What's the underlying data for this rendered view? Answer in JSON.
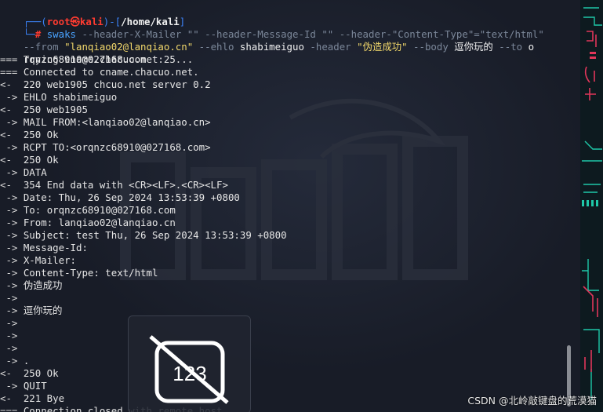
{
  "prompt": {
    "corner_top": "┌──(",
    "user": "root㉿kali",
    "mid": ")-[",
    "path": "/home/kali",
    "close": "]",
    "corner_bottom": "└─",
    "symbol": "#"
  },
  "command": {
    "tool": "swaks",
    "line1_rest": " --header-X-Mailer \"\" --header-Message-Id \"\" --header-\"Content-Type\"=\"text/html\"",
    "line2_a": "--from ",
    "line2_from": "\"lanqiao02@lanqiao.cn\"",
    "line2_b": " --ehlo ",
    "line2_ehlo": "shabimeiguo",
    "line2_c": " -header ",
    "line2_header": "\"伪造成功\"",
    "line2_d": " --body ",
    "line2_body": "逗你玩的",
    "line2_e": " --to ",
    "line2_to_start": "o",
    "line3": "rqnzc68910@027168.com"
  },
  "output_lines": [
    {
      "prefix": "===",
      "text": " Trying cname.chacuo.net:25..."
    },
    {
      "prefix": "===",
      "text": " Connected to cname.chacuo.net."
    },
    {
      "prefix": "<-",
      "text": "  220 web1905 chcuo.net server 0.2"
    },
    {
      "prefix": " ->",
      "text": " EHLO shabimeiguo"
    },
    {
      "prefix": "<-",
      "text": "  250 web1905"
    },
    {
      "prefix": " ->",
      "text": " MAIL FROM:<lanqiao02@lanqiao.cn>"
    },
    {
      "prefix": "<-",
      "text": "  250 Ok"
    },
    {
      "prefix": " ->",
      "text": " RCPT TO:<orqnzc68910@027168.com>"
    },
    {
      "prefix": "<-",
      "text": "  250 Ok"
    },
    {
      "prefix": " ->",
      "text": " DATA"
    },
    {
      "prefix": "<-",
      "text": "  354 End data with <CR><LF>.<CR><LF>"
    },
    {
      "prefix": " ->",
      "text": " Date: Thu, 26 Sep 2024 13:53:39 +0800"
    },
    {
      "prefix": " ->",
      "text": " To: orqnzc68910@027168.com"
    },
    {
      "prefix": " ->",
      "text": " From: lanqiao02@lanqiao.cn"
    },
    {
      "prefix": " ->",
      "text": " Subject: test Thu, 26 Sep 2024 13:53:39 +0800"
    },
    {
      "prefix": " ->",
      "text": " Message-Id:"
    },
    {
      "prefix": " ->",
      "text": " X-Mailer:"
    },
    {
      "prefix": " ->",
      "text": " Content-Type: text/html"
    },
    {
      "prefix": " ->",
      "text": " 伪造成功"
    },
    {
      "prefix": " ->",
      "text": ""
    },
    {
      "prefix": " ->",
      "text": " 逗你玩的"
    },
    {
      "prefix": " ->",
      "text": ""
    },
    {
      "prefix": " ->",
      "text": ""
    },
    {
      "prefix": " ->",
      "text": ""
    },
    {
      "prefix": " ->",
      "text": " ."
    },
    {
      "prefix": "<-",
      "text": "  250 Ok"
    },
    {
      "prefix": " ->",
      "text": " QUIT"
    },
    {
      "prefix": "<-",
      "text": "  221 Bye"
    },
    {
      "prefix": "===",
      "text": " Connection closed with remote host."
    }
  ],
  "overlay": {
    "icon_name": "no-image-icon",
    "icon_text": "123"
  },
  "credit": "CSDN @北岭敲键盘的荒漠猫",
  "colors": {
    "background": "#181c27",
    "prompt_blue": "#3b82f6",
    "prompt_red": "#ff3b30",
    "string_yellow": "#f2d86b",
    "option_gray": "#7b8799"
  }
}
